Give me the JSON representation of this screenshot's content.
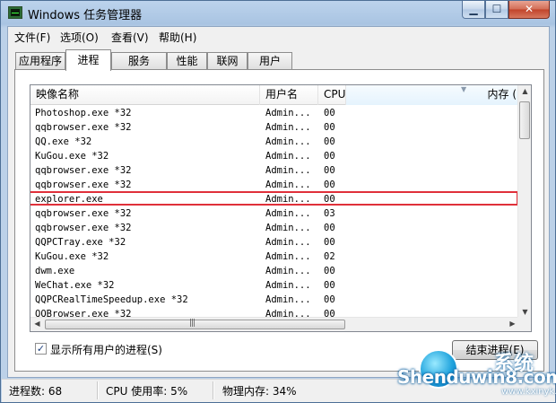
{
  "window": {
    "title": "Windows 任务管理器",
    "minimize": "▁",
    "maximize": "☐",
    "close": "✕"
  },
  "menu": [
    "文件(F)",
    "选项(O)",
    "查看(V)",
    "帮助(H)"
  ],
  "tabs": [
    {
      "label": "应用程序",
      "active": false
    },
    {
      "label": "进程",
      "active": true
    },
    {
      "label": "服务",
      "active": false
    },
    {
      "label": "性能",
      "active": false
    },
    {
      "label": "联网",
      "active": false
    },
    {
      "label": "用户",
      "active": false
    }
  ],
  "columns": {
    "name": "映像名称",
    "user": "用户名",
    "cpu": "CPU",
    "memory": "内存 ("
  },
  "processes": [
    {
      "name": "Photoshop.exe *32",
      "user": "Admin...",
      "cpu": "00"
    },
    {
      "name": "qqbrowser.exe *32",
      "user": "Admin...",
      "cpu": "00"
    },
    {
      "name": "QQ.exe *32",
      "user": "Admin...",
      "cpu": "00"
    },
    {
      "name": "KuGou.exe *32",
      "user": "Admin...",
      "cpu": "00"
    },
    {
      "name": "qqbrowser.exe *32",
      "user": "Admin...",
      "cpu": "00"
    },
    {
      "name": "qqbrowser.exe *32",
      "user": "Admin...",
      "cpu": "00"
    },
    {
      "name": "explorer.exe",
      "user": "Admin...",
      "cpu": "00"
    },
    {
      "name": "qqbrowser.exe *32",
      "user": "Admin...",
      "cpu": "03"
    },
    {
      "name": "qqbrowser.exe *32",
      "user": "Admin...",
      "cpu": "00"
    },
    {
      "name": "QQPCTray.exe *32",
      "user": "Admin...",
      "cpu": "00"
    },
    {
      "name": "KuGou.exe *32",
      "user": "Admin...",
      "cpu": "02"
    },
    {
      "name": "dwm.exe",
      "user": "Admin...",
      "cpu": "00"
    },
    {
      "name": "WeChat.exe *32",
      "user": "Admin...",
      "cpu": "00"
    },
    {
      "name": "QQPCRealTimeSpeedup.exe *32",
      "user": "Admin...",
      "cpu": "00"
    },
    {
      "name": "QQBrowser.exe *32",
      "user": "Admin...",
      "cpu": "00"
    }
  ],
  "highlighted_process": "explorer.exe",
  "highlight_color": "#e0303a",
  "show_all_users": {
    "label": "显示所有用户的进程(S)",
    "checked": true
  },
  "end_process_button": "结束进程(E)",
  "status": {
    "processes": "进程数: 68",
    "cpu": "CPU 使用率: 5%",
    "memory": "物理内存: 34%"
  },
  "watermark": {
    "text": "Shenduwin8.com",
    "cn": "系统",
    "url": "www.kxinyk.com"
  }
}
